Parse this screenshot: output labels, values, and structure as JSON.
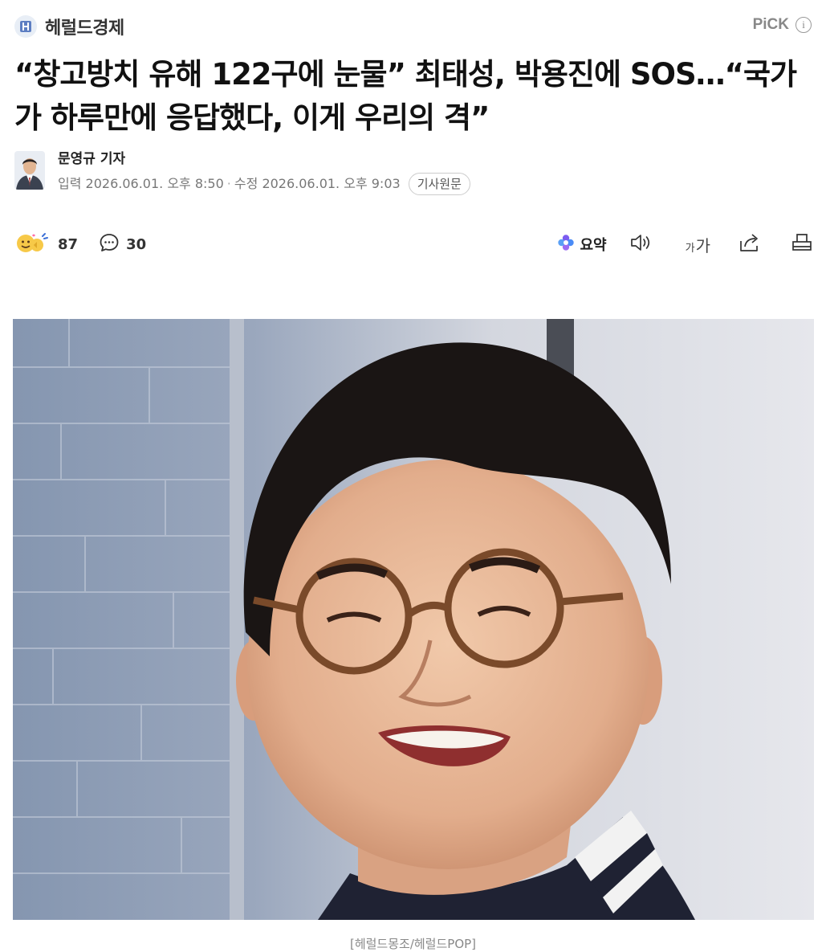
{
  "header": {
    "press_name": "헤럴드경제",
    "pick_label": "PiCK",
    "logo_icon": "press-logo-icon",
    "info_icon": "info-icon"
  },
  "article": {
    "headline": "“창고방치 유해 122구에 눈물” 최태성, 박용진에 SOS…“국가가 하루만에 응답했다, 이게 우리의 격”",
    "reporter": "문영규 기자",
    "published_label": "입력",
    "published": "2026.06.01. 오후 8:50",
    "modified_label": "수정",
    "modified": "2026.06.01. 오후 9:03",
    "source_button": "기사원문"
  },
  "toolbar": {
    "reaction_count": "87",
    "comment_count": "30",
    "summary_label": "요약",
    "font_small": "가",
    "font_large": "가",
    "icons": [
      "reaction-emoji-icon",
      "comment-icon",
      "summary-icon",
      "speaker-icon",
      "font-size-icon",
      "share-icon",
      "print-icon"
    ]
  },
  "photo": {
    "caption": "[헤럴드몽조/헤럴드POP]"
  },
  "colors": {
    "accent_blue": "#3b6fd6",
    "summary_purple": "#7b5cf0",
    "text_dark": "#111111",
    "text_muted": "#777777"
  }
}
